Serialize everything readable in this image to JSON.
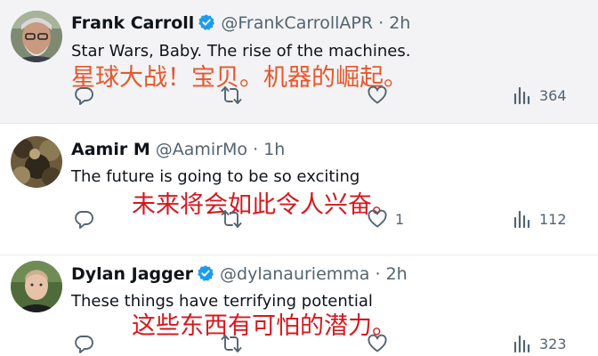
{
  "tweets": [
    {
      "name": "Frank Carroll",
      "verified": true,
      "handle": "@FrankCarrollAPR",
      "separator": "·",
      "time": "2h",
      "text": "Star Wars, Baby. The rise of the machines.",
      "translation": "星球大战！宝贝。机器的崛起。",
      "like_count": "",
      "views": "364"
    },
    {
      "name": "Aamir M",
      "verified": false,
      "handle": "@AamirMo",
      "separator": "·",
      "time": "1h",
      "text": "The future is going to be so exciting",
      "translation": "未来将会如此令人兴奋。",
      "like_count": "1",
      "views": "112"
    },
    {
      "name": "Dylan Jagger",
      "verified": true,
      "handle": "@dylanauriemma",
      "separator": "·",
      "time": "2h",
      "text": "These things have terrifying potential",
      "translation": "这些东西有可怕的潜力。",
      "like_count": "",
      "views": "323"
    }
  ],
  "icons": {
    "reply": "reply-icon",
    "retweet": "retweet-icon",
    "like": "heart-icon",
    "views": "views-icon",
    "verified": "verified-badge-icon"
  },
  "colors": {
    "verified_blue": "#1d9bf0",
    "secondary_text": "#536471",
    "overlay_orange": "#e8562b",
    "overlay_red": "#d4181e"
  }
}
